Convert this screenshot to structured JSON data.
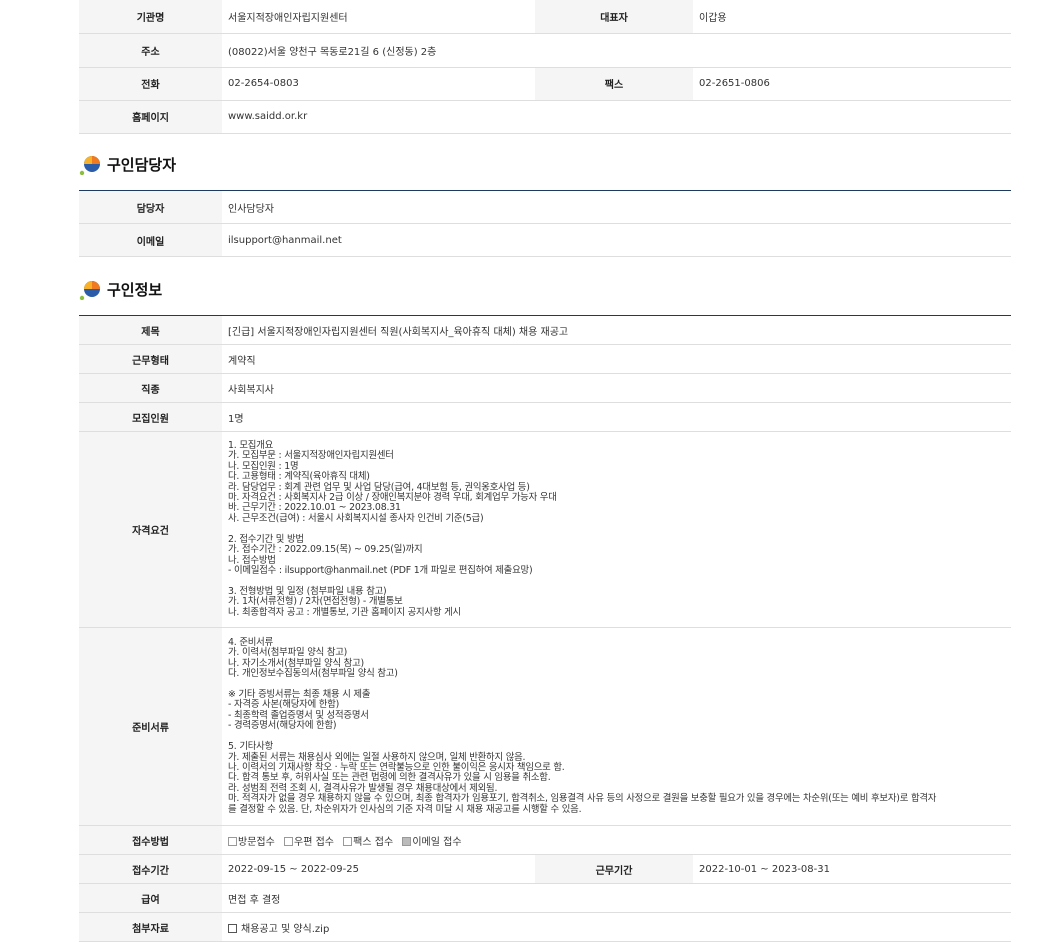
{
  "org": {
    "name_label": "기관명",
    "name": "서울지적장애인자립지원센터",
    "ceo_label": "대표자",
    "ceo": "이갑용",
    "address_label": "주소",
    "address": "(08022)서울 양천구 목동로21길 6 (신정동) 2층",
    "phone_label": "전화",
    "phone": "02-2654-0803",
    "fax_label": "팩스",
    "fax": "02-2651-0806",
    "homepage_label": "홈페이지",
    "homepage": "www.saidd.or.kr"
  },
  "contact_section": {
    "title": "구인담당자",
    "person_label": "담당자",
    "person": "인사담당자",
    "email_label": "이메일",
    "email": "ilsupport@hanmail.net"
  },
  "job_section": {
    "title": "구인정보",
    "subject_label": "제목",
    "subject": "[긴급] 서울지적장애인자립지원센터 직원(사회복지사_육아휴직 대체) 채용 재공고",
    "worktype_label": "근무형태",
    "worktype": "계약직",
    "occupation_label": "직종",
    "occupation": "사회복지사",
    "headcount_label": "모집인원",
    "headcount": "1명",
    "requirements_label": "자격요건",
    "requirements": "1. 모집개요\n가. 모집부문 : 서울지적장애인자립지원센터\n나. 모집인원 : 1명\n다. 고용형태 : 계약직(육아휴직 대체)\n라. 담당업무 : 회계 관련 업무 및 사업 담당(급여, 4대보험 등, 권익옹호사업 등)\n마. 자격요건 : 사회복지사 2급 이상 / 장애인복지분야 경력 우대, 회계업무 가능자 우대\n바. 근무기간 : 2022.10.01 ~ 2023.08.31\n사. 근무조건(급여) : 서울시 사회복지시설 종사자 인건비 기준(5급)\n\n2. 접수기간 및 방법\n가. 접수기간 : 2022.09.15(목) ~ 09.25(일)까지\n나. 접수방법\n- 이메일접수 : ilsupport@hanmail.net (PDF 1개 파일로 편집하여 제출요망)\n\n3. 전형방법 및 일정 (첨부파일 내용 참고)\n가. 1차(서류전형) / 2차(면접전형) - 개별통보\n나. 최종합격자 공고 : 개별통보, 기관 홈페이지 공지사항 게시",
    "documents_label": "준비서류",
    "documents": "4. 준비서류\n가. 이력서(첨부파일 양식 참고)\n나. 자기소개서(첨부파일 양식 참고)\n다. 개인정보수집동의서(첨부파일 양식 참고)\n\n※ 기타 증빙서류는 최종 채용 시 제출\n- 자격증 사본(해당자에 한함)\n- 최종학력 졸업증명서 및 성적증명서\n- 경력증명서(해당자에 한함)\n\n5. 기타사항\n가. 제출된 서류는 채용심사 외에는 일절 사용하지 않으며, 일체 반환하지 않음.\n나. 이력서의 기재사항 착오 · 누락 또는 연락불능으로 인한 불이익은 응시자 책임으로 함.\n다. 합격 통보 후, 허위사실 또는 관련 법령에 의한 결격사유가 있을 시 임용을 취소함.\n라. 성범죄 전력 조회 시, 결격사유가 발생될 경우 채용대상에서 제외됨.\n마. 적격자가 없을 경우 채용하지 않을 수 있으며, 최종 합격자가 임용포기, 합격취소, 임용결격 사유 등의 사정으로 결원을 보충할 필요가 있을 경우에는 차순위(또는 예비 후보자)로 합격자\n를 결정할 수 있음. 단, 차순위자가 인사심의 기준 자격 미달 시 채용 재공고를 시행할 수 있음.",
    "method_label": "접수방법",
    "methods": [
      {
        "label": "방문접수",
        "checked": false
      },
      {
        "label": "우편 접수",
        "checked": false
      },
      {
        "label": "팩스 접수",
        "checked": false
      },
      {
        "label": "이메일 접수",
        "checked": true
      }
    ],
    "period_label": "접수기간",
    "period": "2022-09-15 ~ 2022-09-25",
    "workperiod_label": "근무기간",
    "workperiod": "2022-10-01 ~ 2023-08-31",
    "salary_label": "급여",
    "salary": "면접 후 결정",
    "attach_label": "첨부자료",
    "attach": "채용공고 및 양식.zip"
  },
  "colors": {
    "header_bg": "#f5f5f5",
    "line": "#1e3a5f",
    "icon_orange": "#f07a1f",
    "icon_blue": "#2a5caa",
    "icon_green": "#8cbf3f"
  }
}
